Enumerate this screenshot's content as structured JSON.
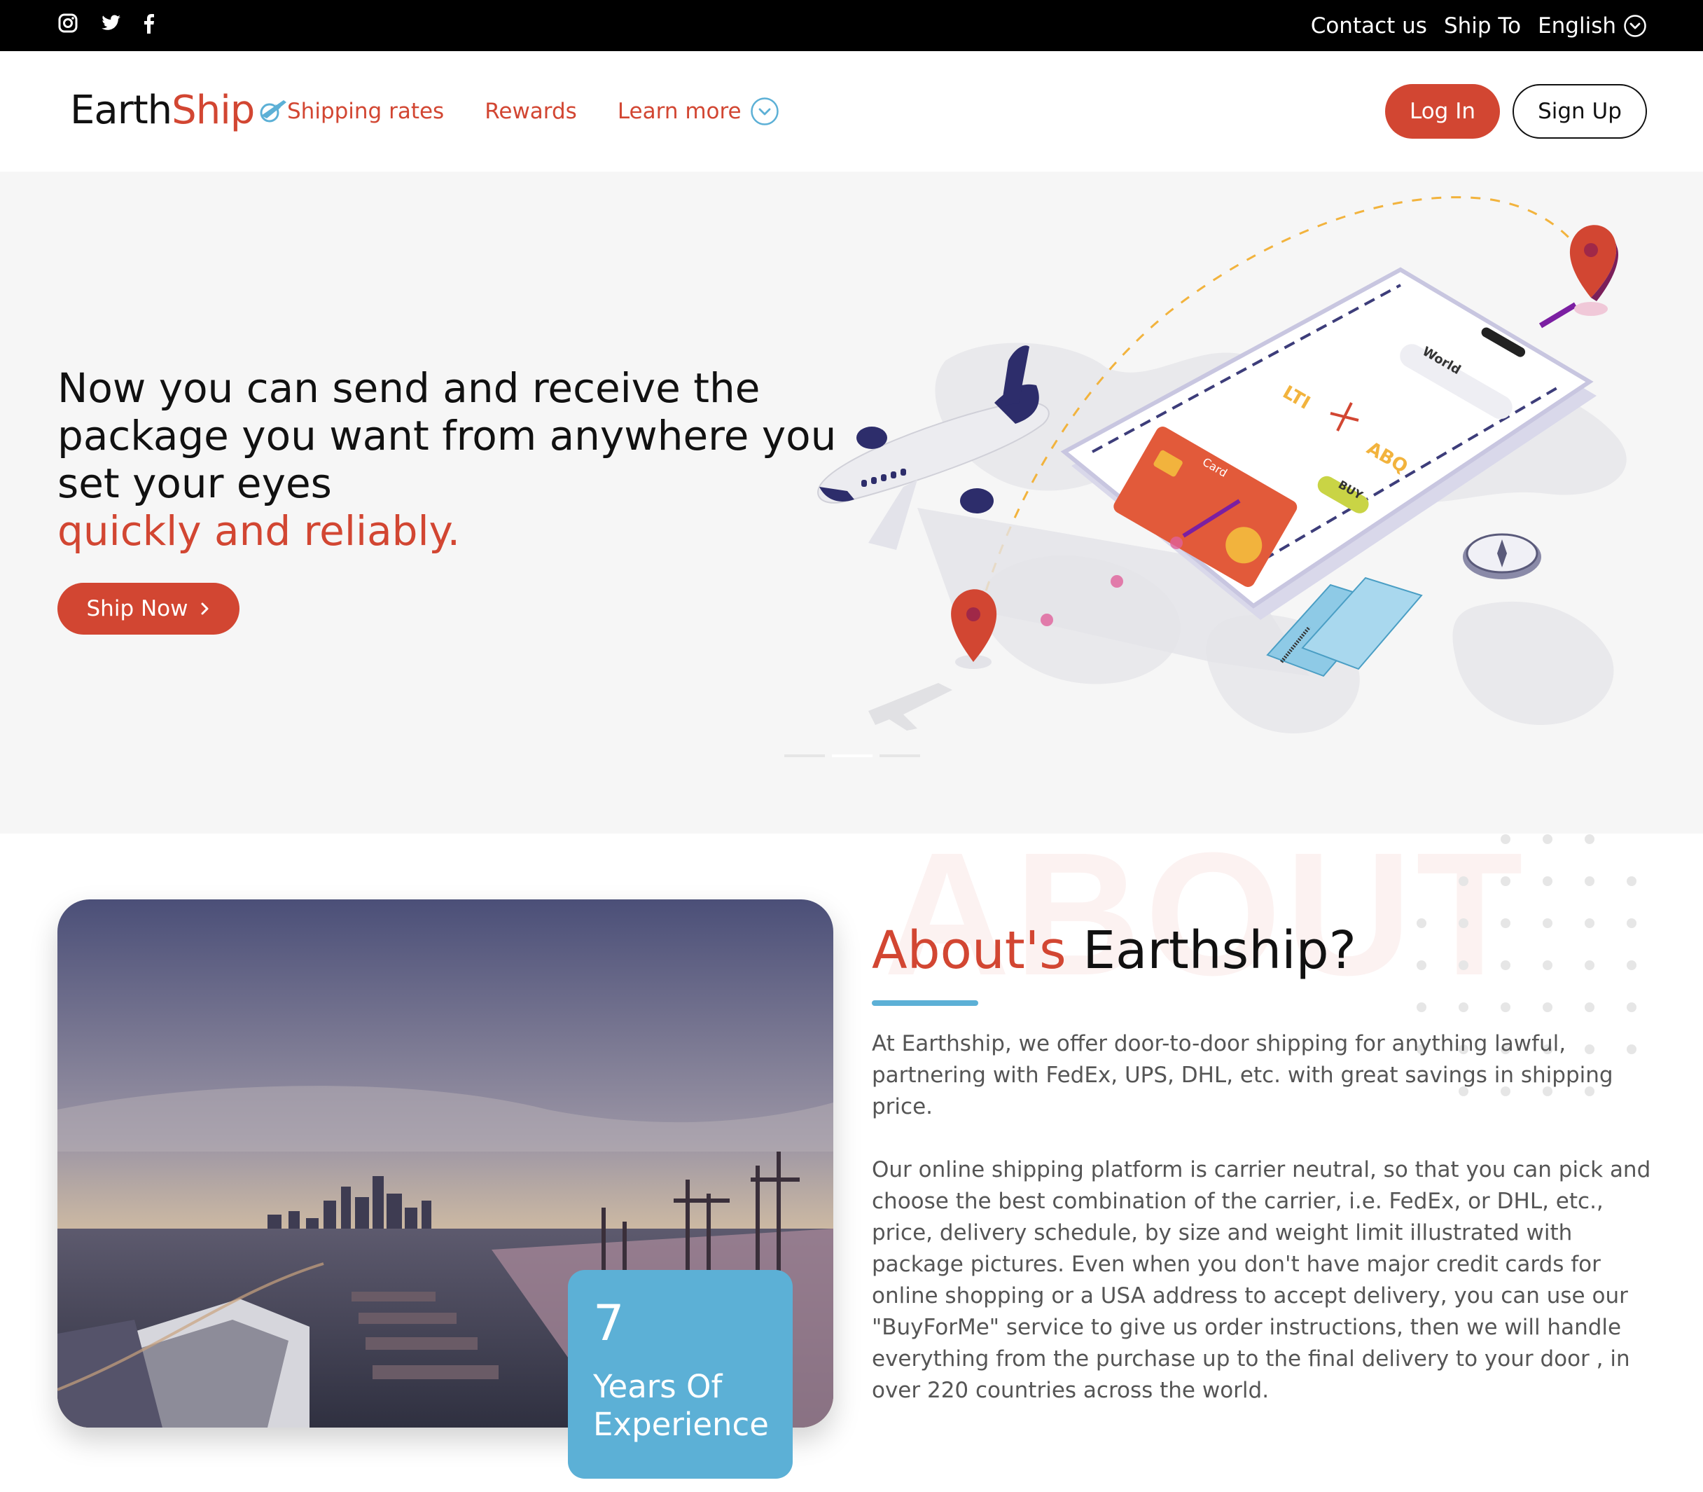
{
  "topbar": {
    "social_icons": [
      "instagram-icon",
      "twitter-icon",
      "facebook-icon"
    ],
    "contact": "Contact us",
    "ship_to": "Ship To",
    "language": "English"
  },
  "nav": {
    "logo_part1": "Earth",
    "logo_part2": "Ship",
    "links": [
      "Shipping rates",
      "Rewards",
      "Learn more"
    ],
    "login": "Log In",
    "signup": "Sign Up"
  },
  "hero": {
    "title": "Now you can send and receive the package you want from anywhere you set your eyes",
    "accent": "quickly and reliably.",
    "cta": "Ship Now",
    "illustration": {
      "card_label": "Card",
      "buy_label": "BUY",
      "from_code": "LTI",
      "to_code": "ABQ",
      "search_label": "World"
    }
  },
  "about": {
    "bg_word": "ABOUT",
    "heading_accent": "About's",
    "heading_rest": "Earthship?",
    "paragraph1": "At Earthship, we offer door-to-door shipping for anything lawful, partnering with FedEx, UPS, DHL, etc. with great savings in shipping price.",
    "paragraph2": "Our online shipping platform is carrier neutral, so that you can pick and choose the best combination of the carrier, i.e. FedEx, or DHL, etc., price, delivery schedule, by size and weight limit illustrated with package pictures. Even when you don't have major credit cards for online shopping or a USA address to accept delivery, you can use our \"BuyForMe\" service to give us order instructions, then we will handle everything from the purchase up to the final delivery to your door , in over 220 countries across the world.",
    "experience_number": "7",
    "experience_label": "Years Of Experience"
  },
  "colors": {
    "brand_red": "#d24632",
    "accent_blue": "#5cb0d6",
    "hero_bg": "#f6f6f6",
    "topbar_bg": "#000000"
  }
}
